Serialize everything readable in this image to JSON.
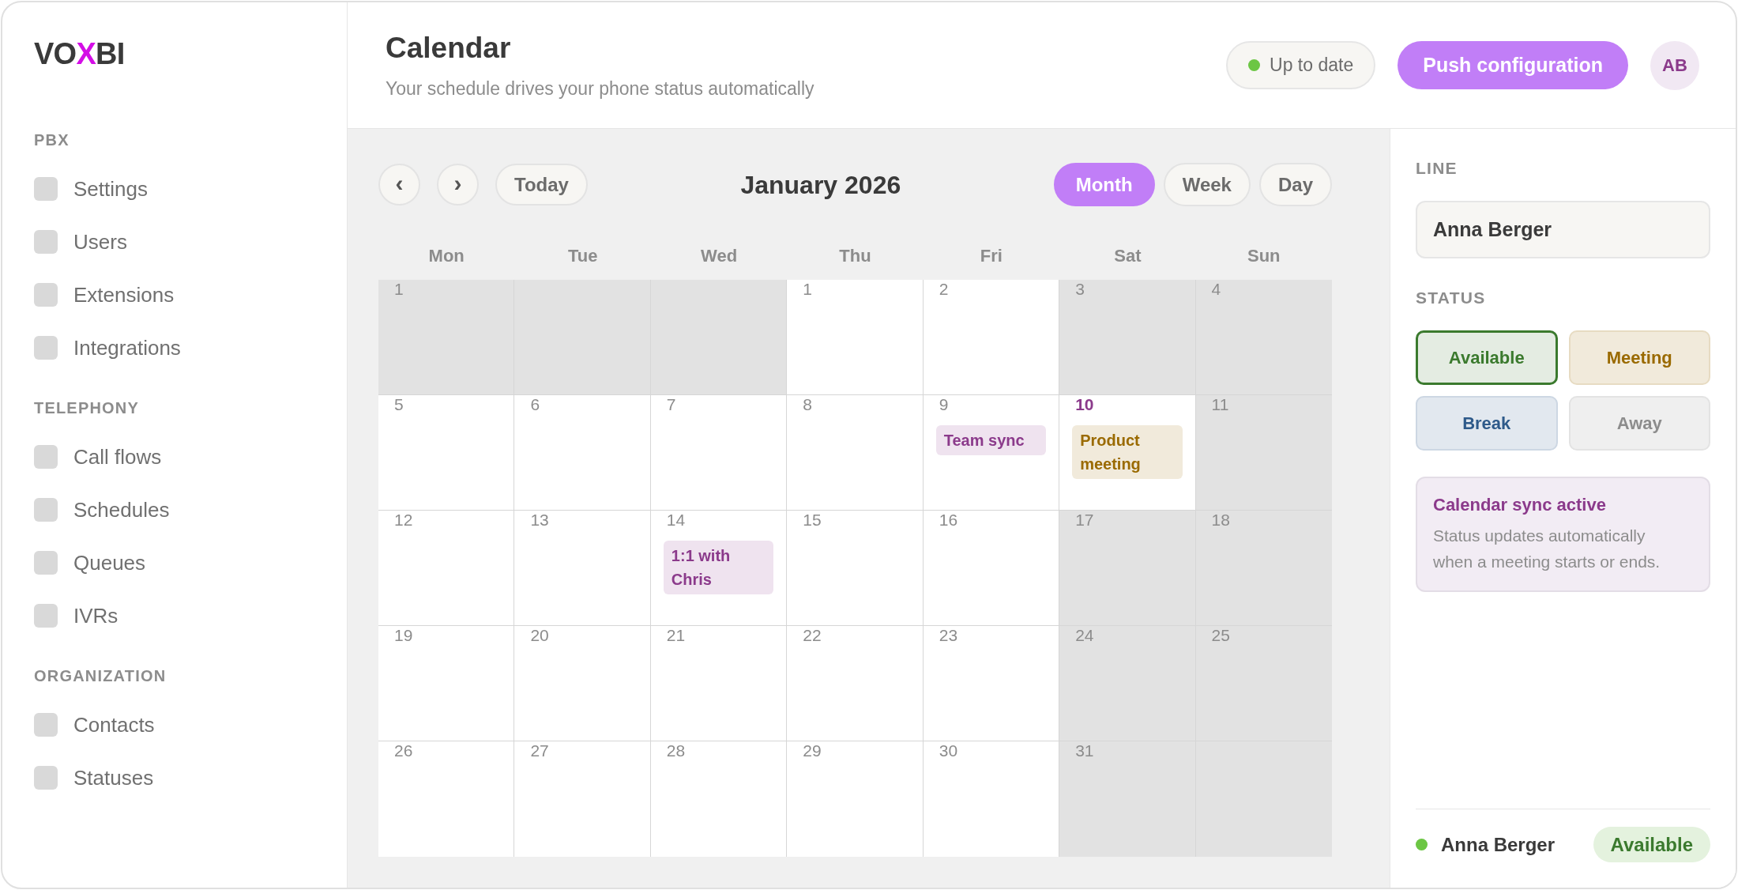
{
  "brand": {
    "logo": [
      {
        "text": "VO",
        "accent": false
      },
      {
        "text": "X",
        "accent": true
      },
      {
        "text": "BI",
        "accent": false
      }
    ]
  },
  "sidebar": {
    "sections": [
      {
        "title": "PBX",
        "items": [
          {
            "label": "Settings"
          },
          {
            "label": "Users"
          },
          {
            "label": "Extensions"
          },
          {
            "label": "Integrations"
          }
        ]
      },
      {
        "title": "TELEPHONY",
        "items": [
          {
            "label": "Call flows"
          },
          {
            "label": "Schedules"
          },
          {
            "label": "Queues"
          },
          {
            "label": "IVRs"
          }
        ]
      },
      {
        "title": "ORGANIZATION",
        "items": [
          {
            "label": "Contacts"
          },
          {
            "label": "Statuses"
          }
        ]
      }
    ]
  },
  "header": {
    "title": "Calendar",
    "subtitle": "Your schedule drives your phone status automatically",
    "sync_status": "Up to date",
    "push_button": "Push configuration",
    "avatar": "AB"
  },
  "calendar": {
    "prev_button": "‹",
    "next_button": "›",
    "today_button": "Today",
    "month": "January 2026",
    "views": [
      {
        "label": "Month",
        "selected": true
      },
      {
        "label": "Week",
        "selected": false
      },
      {
        "label": "Day",
        "selected": false
      }
    ],
    "weekdays": [
      "Mon",
      "Tue",
      "Wed",
      "Thu",
      "Fri",
      "Sat",
      "Sun"
    ],
    "weeks": [
      [
        {
          "day": "1",
          "muted": true,
          "today": false
        },
        {
          "muted": true
        },
        {
          "muted": true
        },
        {
          "day": "1",
          "muted": false,
          "today": false
        },
        {
          "day": "2",
          "muted": false,
          "today": false
        },
        {
          "day": "3",
          "muted": true,
          "today": false
        },
        {
          "day": "4",
          "muted": true,
          "today": false
        }
      ],
      [
        {
          "day": "5",
          "muted": false,
          "today": false
        },
        {
          "day": "6",
          "muted": false,
          "today": false
        },
        {
          "day": "7",
          "muted": false,
          "today": false
        },
        {
          "day": "8",
          "muted": false,
          "today": false
        },
        {
          "day": "9",
          "muted": false,
          "today": false,
          "events": [
            {
              "title": "Team sync",
              "color": "#8b3a8b"
            }
          ]
        },
        {
          "day": "10",
          "muted": false,
          "today": true,
          "events": [
            {
              "title": "Product meeting",
              "color": "#9a6a00"
            }
          ]
        },
        {
          "day": "11",
          "muted": true,
          "today": false
        }
      ],
      [
        {
          "day": "12",
          "muted": false,
          "today": false
        },
        {
          "day": "13",
          "muted": false,
          "today": false
        },
        {
          "day": "14",
          "muted": false,
          "today": false,
          "events": [
            {
              "title": "1:1 with Chris",
              "color": "#8b3a8b"
            }
          ]
        },
        {
          "day": "15",
          "muted": false,
          "today": false
        },
        {
          "day": "16",
          "muted": false,
          "today": false
        },
        {
          "day": "17",
          "muted": true,
          "today": false
        },
        {
          "day": "18",
          "muted": true,
          "today": false
        }
      ],
      [
        {
          "day": "19",
          "muted": false,
          "today": false
        },
        {
          "day": "20",
          "muted": false,
          "today": false
        },
        {
          "day": "21",
          "muted": false,
          "today": false
        },
        {
          "day": "22",
          "muted": false,
          "today": false
        },
        {
          "day": "23",
          "muted": false,
          "today": false
        },
        {
          "day": "24",
          "muted": true,
          "today": false
        },
        {
          "day": "25",
          "muted": true,
          "today": false
        }
      ],
      [
        {
          "day": "26",
          "muted": false,
          "today": false
        },
        {
          "day": "27",
          "muted": false,
          "today": false
        },
        {
          "day": "28",
          "muted": false,
          "today": false
        },
        {
          "day": "29",
          "muted": false,
          "today": false
        },
        {
          "day": "30",
          "muted": false,
          "today": false
        },
        {
          "day": "31",
          "muted": true,
          "today": false
        },
        {
          "muted": true
        }
      ]
    ]
  },
  "panel": {
    "line_label": "LINE",
    "line_value": "Anna Berger",
    "status_label": "STATUS",
    "statuses": [
      {
        "label": "Available",
        "selected": true,
        "color": "#3b7a2e"
      },
      {
        "label": "Meeting",
        "selected": false,
        "color": "#9a6a00"
      },
      {
        "label": "Break",
        "selected": false,
        "color": "#2e5a8a"
      },
      {
        "label": "Away",
        "selected": false,
        "color": "#8c8c8c"
      }
    ],
    "info": {
      "title": "Calendar sync active",
      "text": "Status updates automatically when a meeting starts or ends."
    },
    "footer": {
      "name": "Anna Berger",
      "status": "Available"
    }
  }
}
